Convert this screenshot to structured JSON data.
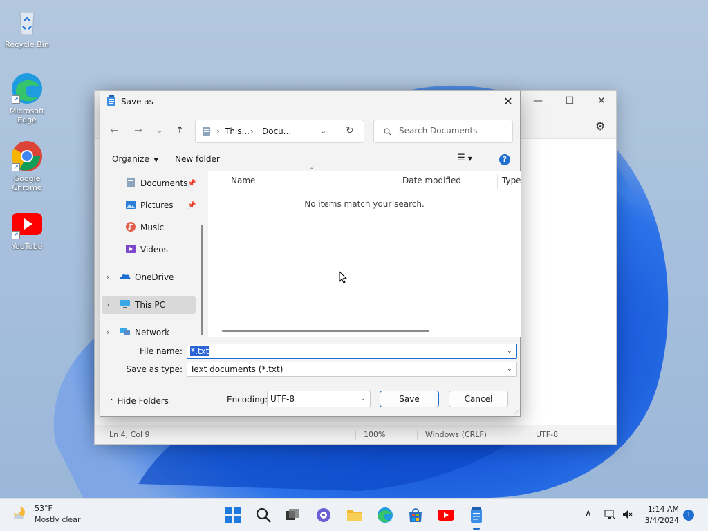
{
  "desktop": {
    "icons": [
      {
        "label": "Recycle Bin"
      },
      {
        "label": "Microsoft Edge"
      },
      {
        "label": "Google Chrome"
      },
      {
        "label": "YouTube"
      }
    ]
  },
  "notepad": {
    "status": {
      "position": "Ln 4, Col 9",
      "zoom": "100%",
      "line_ending": "Windows (CRLF)",
      "encoding": "UTF-8"
    }
  },
  "dialog": {
    "title": "Save as",
    "address": {
      "crumb1": "This...",
      "crumb2": "Docu..."
    },
    "search_placeholder": "Search Documents",
    "commands": {
      "organize": "Organize",
      "new_folder": "New folder"
    },
    "sidebar": {
      "items": [
        {
          "label": "Documents"
        },
        {
          "label": "Pictures"
        },
        {
          "label": "Music"
        },
        {
          "label": "Videos"
        },
        {
          "label": "OneDrive"
        },
        {
          "label": "This PC"
        },
        {
          "label": "Network"
        }
      ]
    },
    "columns": {
      "name": "Name",
      "date": "Date modified",
      "type": "Type"
    },
    "empty_message": "No items match your search.",
    "file_name": {
      "label": "File name:",
      "value": "*.txt"
    },
    "save_as_type": {
      "label": "Save as type:",
      "value": "Text documents (*.txt)"
    },
    "hide_folders": "Hide Folders",
    "encoding": {
      "label": "Encoding:",
      "value": "UTF-8"
    },
    "buttons": {
      "save": "Save",
      "cancel": "Cancel"
    }
  },
  "taskbar": {
    "weather": {
      "temp": "53°F",
      "condition": "Mostly clear"
    },
    "clock": {
      "time": "1:14 AM",
      "date": "3/4/2024"
    },
    "notification_count": "1"
  },
  "colors": {
    "accent": "#1f6fd1",
    "selection": "#2a64d6"
  }
}
